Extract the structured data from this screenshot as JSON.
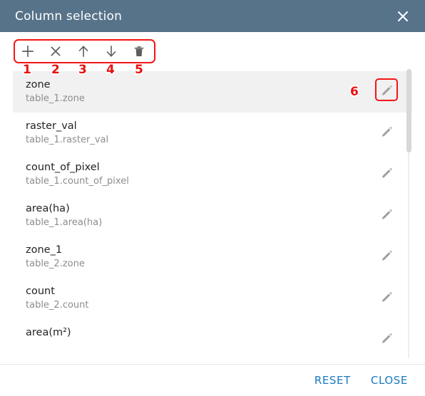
{
  "dialog": {
    "title": "Column selection"
  },
  "header": {
    "close_icon": "close-icon"
  },
  "toolbar": {
    "buttons": [
      {
        "name": "add-column-button",
        "icon": "plus-icon",
        "callout": "1"
      },
      {
        "name": "remove-column-button",
        "icon": "cross-icon",
        "callout": "2"
      },
      {
        "name": "move-up-button",
        "icon": "arrow-up-icon",
        "callout": "3"
      },
      {
        "name": "move-down-button",
        "icon": "arrow-down-icon",
        "callout": "4"
      },
      {
        "name": "delete-button",
        "icon": "trash-icon",
        "callout": "5"
      }
    ]
  },
  "callouts": {
    "n1": "1",
    "n2": "2",
    "n3": "3",
    "n4": "4",
    "n5": "5",
    "n6": "6"
  },
  "list": {
    "rows": [
      {
        "title": "zone",
        "subtitle": "table_1.zone",
        "selected": true,
        "edit_icon": "pencil-icon",
        "edit_highlighted": true
      },
      {
        "title": "raster_val",
        "subtitle": "table_1.raster_val",
        "selected": false,
        "edit_icon": "pencil-icon",
        "edit_highlighted": false
      },
      {
        "title": "count_of_pixel",
        "subtitle": "table_1.count_of_pixel",
        "selected": false,
        "edit_icon": "pencil-icon",
        "edit_highlighted": false
      },
      {
        "title": "area(ha)",
        "subtitle": "table_1.area(ha)",
        "selected": false,
        "edit_icon": "pencil-icon",
        "edit_highlighted": false
      },
      {
        "title": "zone_1",
        "subtitle": "table_2.zone",
        "selected": false,
        "edit_icon": "pencil-icon",
        "edit_highlighted": false
      },
      {
        "title": "count",
        "subtitle": "table_2.count",
        "selected": false,
        "edit_icon": "pencil-icon",
        "edit_highlighted": false
      },
      {
        "title": "area(m²)",
        "subtitle": "",
        "selected": false,
        "edit_icon": "pencil-icon",
        "edit_highlighted": false
      }
    ]
  },
  "footer": {
    "reset_label": "RESET",
    "close_label": "CLOSE"
  },
  "colors": {
    "header_bg": "#57738a",
    "accent_link": "#1b79c0",
    "callout_red": "#e8110f",
    "selected_row_bg": "#f1f1f1"
  }
}
